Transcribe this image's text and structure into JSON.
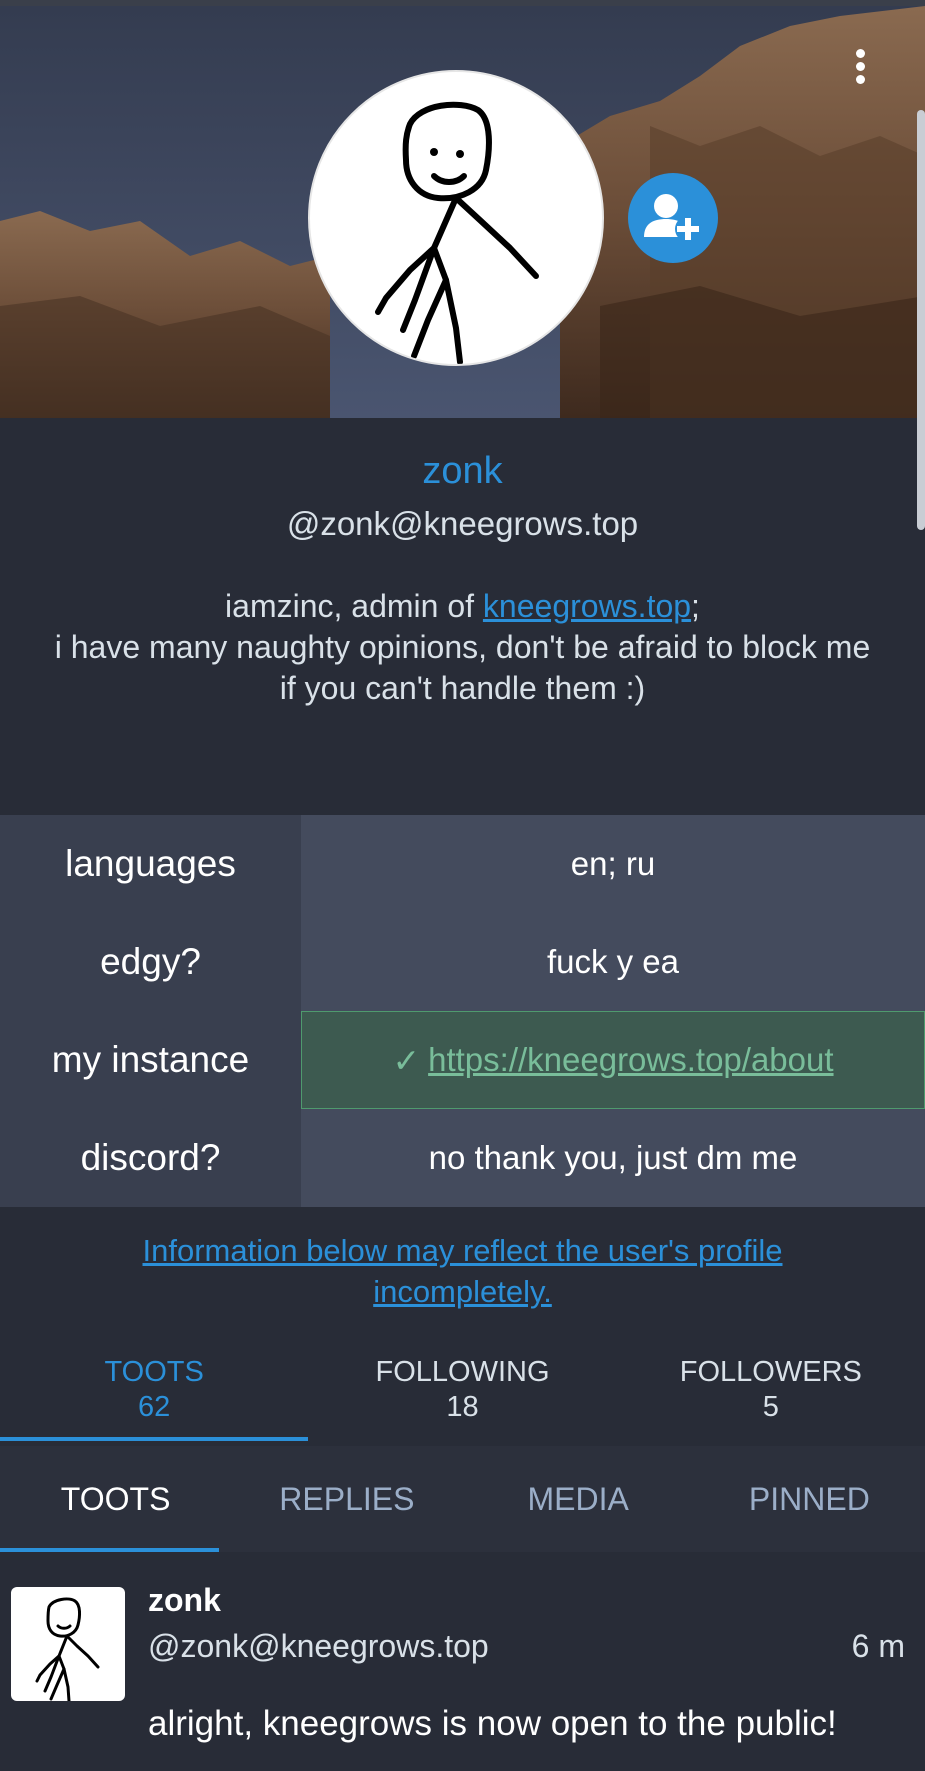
{
  "profile": {
    "display_name": "zonk",
    "handle": "@zonk@kneegrows.top",
    "bio_prefix": "iamzinc, admin of ",
    "bio_link": "kneegrows.top",
    "bio_suffix": ";",
    "bio_line2": "i have many naughty opinions, don't be afraid to block me",
    "bio_line3": "if you can't handle them :)"
  },
  "fields": [
    {
      "name": "languages",
      "value": "en; ru"
    },
    {
      "name": "edgy?",
      "value": "fuck y ea"
    },
    {
      "name": "my instance",
      "check": "✓",
      "value": "https://kneegrows.top/about"
    },
    {
      "name": "discord?",
      "value": "no thank you, just dm me"
    }
  ],
  "notice": {
    "line1": "Information below may reflect the user's profile",
    "line2": "incompletely."
  },
  "counters": [
    {
      "label": "TOOTS",
      "value": "62"
    },
    {
      "label": "FOLLOWING",
      "value": "18"
    },
    {
      "label": "FOLLOWERS",
      "value": "5"
    }
  ],
  "tabs": [
    "TOOTS",
    "REPLIES",
    "MEDIA",
    "PINNED"
  ],
  "status": {
    "name": "zonk",
    "handle": "@zonk@kneegrows.top",
    "time": "6 m",
    "content": "alright, kneegrows is now open to the public!"
  },
  "colors": {
    "accent": "#2b90d9",
    "background": "#282c37",
    "verified": "#79bd9a"
  },
  "icons": {
    "menu": "more-vertical-icon",
    "follow": "add-user-icon"
  }
}
